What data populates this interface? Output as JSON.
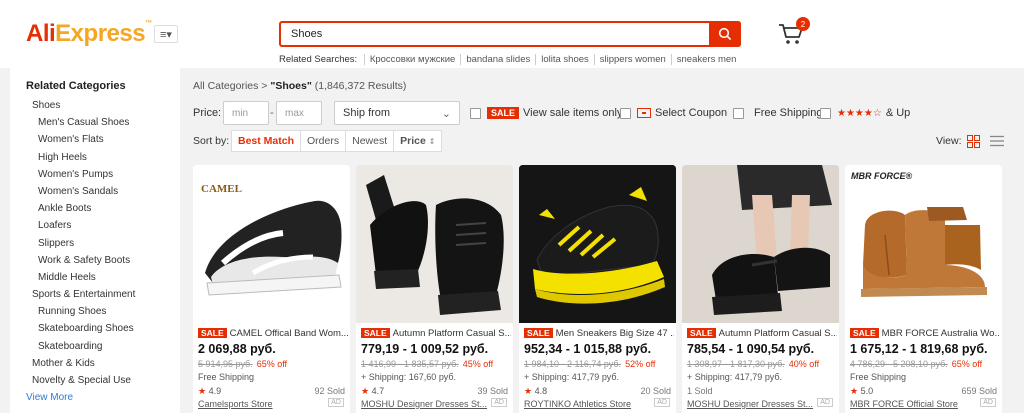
{
  "header": {
    "logo_ali": "Ali",
    "logo_express": "Express",
    "logo_tm": "™",
    "category_menu_icon": "menu-icon",
    "search_value": "Shoes",
    "search_icon": "search-icon",
    "related_label": "Related Searches:",
    "related_searches": [
      "Кроссовки мужские",
      "bandana slides",
      "lolita shoes",
      "slippers women",
      "sneakers men"
    ],
    "cart_icon": "cart-icon",
    "cart_count": "2"
  },
  "sidebar": {
    "title": "Related Categories",
    "items": [
      {
        "label": "Shoes",
        "level": 1
      },
      {
        "label": "Men's Casual Shoes",
        "level": 2
      },
      {
        "label": "Women's Flats",
        "level": 2
      },
      {
        "label": "High Heels",
        "level": 2
      },
      {
        "label": "Women's Pumps",
        "level": 2
      },
      {
        "label": "Women's Sandals",
        "level": 2
      },
      {
        "label": "Ankle Boots",
        "level": 2
      },
      {
        "label": "Loafers",
        "level": 2
      },
      {
        "label": "Slippers",
        "level": 2
      },
      {
        "label": "Work & Safety Boots",
        "level": 2
      },
      {
        "label": "Middle Heels",
        "level": 2
      },
      {
        "label": "Sports & Entertainment",
        "level": 1
      },
      {
        "label": "Running Shoes",
        "level": 2
      },
      {
        "label": "Skateboarding Shoes",
        "level": 2
      },
      {
        "label": "Skateboarding",
        "level": 2
      },
      {
        "label": "Mother & Kids",
        "level": 1
      },
      {
        "label": "Novelty & Special Use",
        "level": 1
      }
    ],
    "view_more": "View More"
  },
  "breadcrumb": {
    "root": "All Categories",
    "separator": ">",
    "query": "\"Shoes\"",
    "count": "(1,846,372 Results)"
  },
  "filters": {
    "price_label": "Price:",
    "min_placeholder": "min",
    "dash": "-",
    "max_placeholder": "max",
    "ship_from": "Ship from",
    "sale_badge": "SALE",
    "sale_label": "View sale items only",
    "coupon_label": "Select Coupon",
    "free_shipping_label": "Free Shipping",
    "stars": "★★★★",
    "star_empty": "☆",
    "up_label": "& Up"
  },
  "sort": {
    "label": "Sort by:",
    "options": [
      "Best Match",
      "Orders",
      "Newest",
      "Price"
    ],
    "view_label": "View:",
    "grid_icon": "grid-view-icon",
    "list_icon": "list-view-icon"
  },
  "products": [
    {
      "sale": "SALE",
      "title": "CAMEL Offical Band Wom...",
      "price": "2 069,88 руб.",
      "orig": "5 914,95 руб.",
      "off": "65% off",
      "ship": "Free Shipping",
      "rating": "4.9",
      "sold": "92 Sold",
      "store": "Camelsports Store",
      "ad": "AD",
      "brand": "CAMEL"
    },
    {
      "sale": "SALE",
      "title": "Autumn Platform Casual S...",
      "price": "779,19 - 1 009,52 руб.",
      "orig": "1 416,99 - 1 835,57 руб.",
      "off": "45% off",
      "ship": "+ Shipping: 167,60 руб.",
      "rating": "4.7",
      "sold": "39 Sold",
      "store": "MOSHU Designer Dresses St...",
      "ad": "AD",
      "brand": ""
    },
    {
      "sale": "SALE",
      "title": "Men Sneakers Big Size 47 ...",
      "price": "952,34 - 1 015,88 руб.",
      "orig": "1 984,10 - 2 116,74 руб.",
      "off": "52% off",
      "ship": "+ Shipping: 417,79 руб.",
      "rating": "4.8",
      "sold": "20 Sold",
      "store": "ROYTINKO Athletics Store",
      "ad": "AD",
      "brand": ""
    },
    {
      "sale": "SALE",
      "title": "Autumn Platform Casual S...",
      "price": "785,54 - 1 090,54 руб.",
      "orig": "1 308,97 - 1 817,30 руб.",
      "off": "40% off",
      "ship": "+ Shipping: 417,79 руб.",
      "rating": "",
      "sold": "1 Sold",
      "store": "MOSHU Designer Dresses St...",
      "ad": "AD",
      "brand": ""
    },
    {
      "sale": "SALE",
      "title": "MBR FORCE Australia Wo...",
      "price": "1 675,12 - 1 819,68 руб.",
      "orig": "4 786,29 - 5 208,10 руб.",
      "off": "65% off",
      "ship": "Free Shipping",
      "rating": "5.0",
      "sold": "659 Sold",
      "store": "MBR FORCE Official Store",
      "ad": "AD",
      "brand": "MBR FORCE®"
    }
  ]
}
